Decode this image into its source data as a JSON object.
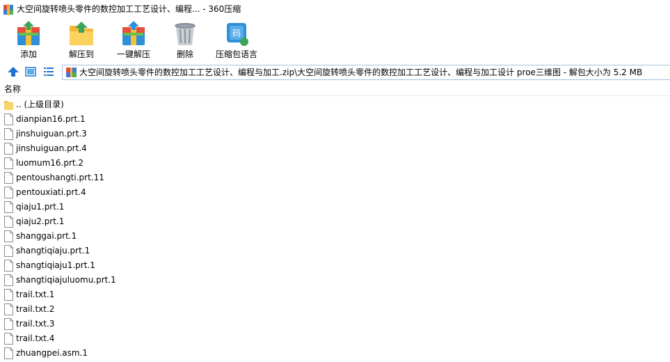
{
  "window": {
    "title": "大空间旋转喷头零件的数控加工工艺设计、编程... - 360压缩"
  },
  "toolbar": {
    "buttons": [
      {
        "label": "添加",
        "icon": "add-archive-icon"
      },
      {
        "label": "解压到",
        "icon": "extract-to-icon"
      },
      {
        "label": "一键解压",
        "icon": "one-click-extract-icon"
      },
      {
        "label": "删除",
        "icon": "delete-trash-icon"
      },
      {
        "label": "压缩包语言",
        "icon": "archive-language-icon"
      }
    ]
  },
  "addressbar": {
    "icons": [
      "up-arrow-icon",
      "thumbnail-view-icon",
      "list-view-icon",
      "archive-icon"
    ],
    "path": "大空间旋转喷头零件的数控加工工艺设计、编程与加工.zip\\大空间旋转喷头零件的数控加工工艺设计、编程与加工设计 proe三维图 - 解包大小为 5.2 MB"
  },
  "list": {
    "column_name": "名称",
    "parent_entry": ".. (上级目录)",
    "files": [
      "dianpian16.prt.1",
      "jinshuiguan.prt.3",
      "jinshuiguan.prt.4",
      "luomum16.prt.2",
      "pentoushangti.prt.11",
      "pentouxiati.prt.4",
      "qiaju1.prt.1",
      "qiaju2.prt.1",
      "shanggai.prt.1",
      "shangtiqiaju.prt.1",
      "shangtiqiaju1.prt.1",
      "shangtiqiajuluomu.prt.1",
      "trail.txt.1",
      "trail.txt.2",
      "trail.txt.3",
      "trail.txt.4",
      "zhuangpei.asm.1"
    ]
  },
  "colors": {
    "accent": "#1e73d2",
    "folder": "#f4c24f",
    "border": "#a9c0da"
  }
}
